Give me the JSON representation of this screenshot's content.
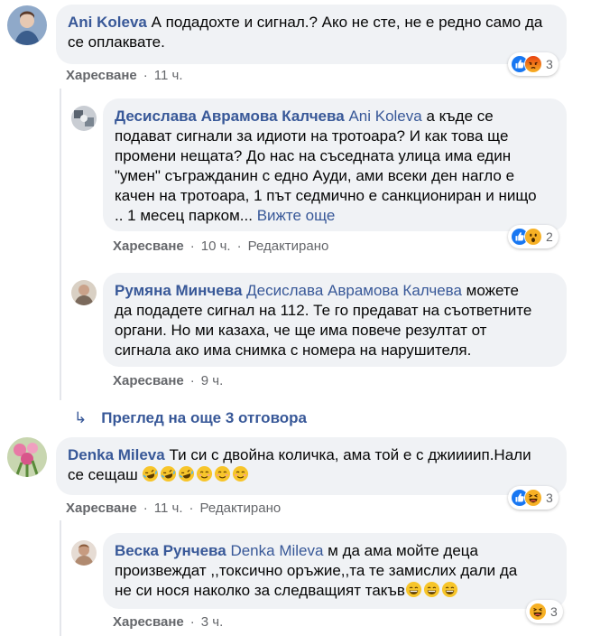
{
  "comments": [
    {
      "author": "Ani Koleva",
      "text": "А подадохте и сигнал.? Ако не сте, не е редно само да се оплаквате.",
      "like_label": "Харесване",
      "time": "11 ч.",
      "reactions": [
        "like",
        "angry"
      ],
      "reaction_count": "3",
      "replies": [
        {
          "author": "Десислава Аврамова Калчева",
          "mention": "Ani Koleva",
          "text_line1_rest": " а къде се",
          "text_lines": [
            "подават сигнали за идиоти на тротоара? И как това ще",
            "промени нещата? До нас на съседната улица има един",
            "\"умен\" съгражданин с едно Ауди, ами всеки ден нагло е",
            "качен на тротоара, 1 път седмично е санкциониран и нищо",
            ".. 1 месец парком... "
          ],
          "see_more": "Вижте още",
          "like_label": "Харесване",
          "time": "10 ч.",
          "edited": "Редактирано",
          "reactions": [
            "like",
            "wow"
          ],
          "reaction_count": "2"
        },
        {
          "author": "Румяна Минчева",
          "mention": "Десислава Аврамова Калчева",
          "text_line1_rest": " можете",
          "text_lines": [
            "да подадете сигнал на 112. Те го предават на съответните",
            "органи. Но ми казаха, че ще има повече резултат от",
            "сигнала ако има снимка с номера на нарушителя."
          ],
          "like_label": "Харесване",
          "time": "9 ч."
        }
      ],
      "more_replies": "Преглед на още 3 отговора"
    },
    {
      "author": "Denka Mileva",
      "text_line1": " Ти си с двойна количка, ама той е с джиииип.Нали",
      "text_line2": "се сещаш",
      "emojis": [
        "laugh",
        "laugh",
        "laugh",
        "smile",
        "smile",
        "smile"
      ],
      "like_label": "Харесване",
      "time": "11 ч.",
      "edited": "Редактирано",
      "reactions": [
        "like",
        "haha"
      ],
      "reaction_count": "3",
      "replies": [
        {
          "author": "Веска Рунчева",
          "mention": "Denka Mileva",
          "text_line1_rest": " м да ама мойте деца",
          "text_lines": [
            "произвеждат ,,токсично оръжие,,та те замислих дали да",
            "не си нося наколко за следващият такъв"
          ],
          "emojis": [
            "grin",
            "grin",
            "grin"
          ],
          "like_label": "Харесване",
          "time": "3 ч.",
          "reactions": [
            "haha"
          ],
          "reaction_count": "3"
        }
      ]
    }
  ],
  "colors": {
    "name": "#385898",
    "bubble": "#f0f2f5",
    "meta": "#65676b",
    "like_blue": "#1877f2",
    "angry": "#e9710f",
    "yellow": "#f7b125"
  }
}
